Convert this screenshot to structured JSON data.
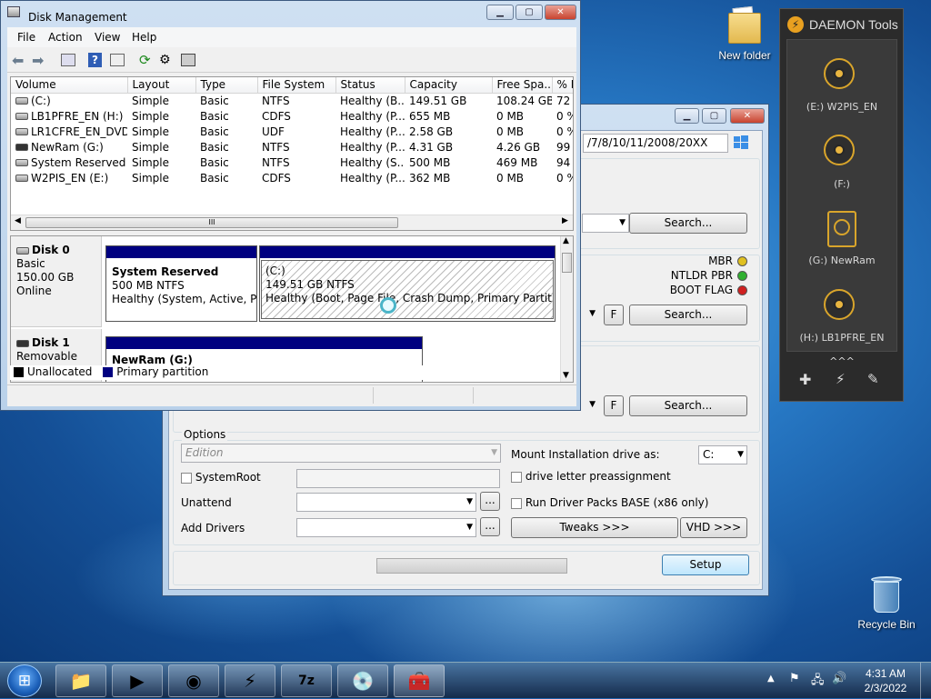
{
  "desktop": {
    "new_folder_label": "New folder",
    "recycle_bin_label": "Recycle Bin"
  },
  "disk_mgmt": {
    "title": "Disk Management",
    "menu": [
      "File",
      "Action",
      "View",
      "Help"
    ],
    "columns": [
      "Volume",
      "Layout",
      "Type",
      "File System",
      "Status",
      "Capacity",
      "Free Spa...",
      "% F"
    ],
    "volumes": [
      {
        "name": "(C:)",
        "layout": "Simple",
        "type": "Basic",
        "fs": "NTFS",
        "status": "Healthy (B...",
        "capacity": "149.51 GB",
        "free": "108.24 GB",
        "pct": "72"
      },
      {
        "name": "LB1PFRE_EN (H:)",
        "layout": "Simple",
        "type": "Basic",
        "fs": "CDFS",
        "status": "Healthy (P...",
        "capacity": "655 MB",
        "free": "0 MB",
        "pct": "0 %"
      },
      {
        "name": "LR1CFRE_EN_DVD ...",
        "layout": "Simple",
        "type": "Basic",
        "fs": "UDF",
        "status": "Healthy (P...",
        "capacity": "2.58 GB",
        "free": "0 MB",
        "pct": "0 %"
      },
      {
        "name": "NewRam (G:)",
        "layout": "Simple",
        "type": "Basic",
        "fs": "NTFS",
        "status": "Healthy (P...",
        "capacity": "4.31 GB",
        "free": "4.26 GB",
        "pct": "99"
      },
      {
        "name": "System Reserved",
        "layout": "Simple",
        "type": "Basic",
        "fs": "NTFS",
        "status": "Healthy (S...",
        "capacity": "500 MB",
        "free": "469 MB",
        "pct": "94"
      },
      {
        "name": "W2PIS_EN (E:)",
        "layout": "Simple",
        "type": "Basic",
        "fs": "CDFS",
        "status": "Healthy (P...",
        "capacity": "362 MB",
        "free": "0 MB",
        "pct": "0 %"
      }
    ],
    "disk0": {
      "name": "Disk 0",
      "kind": "Basic",
      "size": "150.00 GB",
      "state": "Online",
      "p1_name": "System Reserved",
      "p1_size": "500 MB NTFS",
      "p1_status": "Healthy (System, Active, Prim",
      "p2_name": "(C:)",
      "p2_size": "149.51 GB NTFS",
      "p2_status": "Healthy (Boot, Page File, Crash Dump, Primary Partition)"
    },
    "disk1": {
      "name": "Disk 1",
      "kind": "Removable",
      "p1_name": "NewRam  (G:)"
    },
    "legend_unallocated": "Unallocated",
    "legend_primary": "Primary partition",
    "legend_unallocated_color": "#000000",
    "legend_primary_color": "#000080"
  },
  "winntsetup": {
    "os_versions": "/7/8/10/11/2008/20XX",
    "search1": "Search...",
    "search2": "Search...",
    "search3": "Search...",
    "f_label": "F",
    "mbr": "MBR",
    "ntldr": "NTLDR PBR",
    "bootflag": "BOOT FLAG",
    "options_label": "Options",
    "edition_placeholder": "Edition",
    "systemroot": "SystemRoot",
    "unattend": "Unattend",
    "add_drivers": "Add Drivers",
    "dots": "...",
    "mount_label": "Mount Installation drive as:",
    "mount_value": "C:",
    "preassign": "drive letter preassignment",
    "driverpacks": "Run Driver Packs BASE (x86 only)",
    "tweaks": "Tweaks >>>",
    "vhd": "VHD >>>",
    "setup": "Setup",
    "status_colors": {
      "mbr": "#e0c020",
      "ntldr": "#30b030",
      "bootflag": "#d02020"
    }
  },
  "daemon": {
    "title": "DAEMON Tools",
    "drives": [
      "(E:) W2PIS_EN",
      "(F:)",
      "(G:) NewRam",
      "(H:) LB1PFRE_EN"
    ],
    "collapse": "^^^"
  },
  "taskbar": {
    "time": "4:31 AM",
    "date": "2/3/2022"
  }
}
